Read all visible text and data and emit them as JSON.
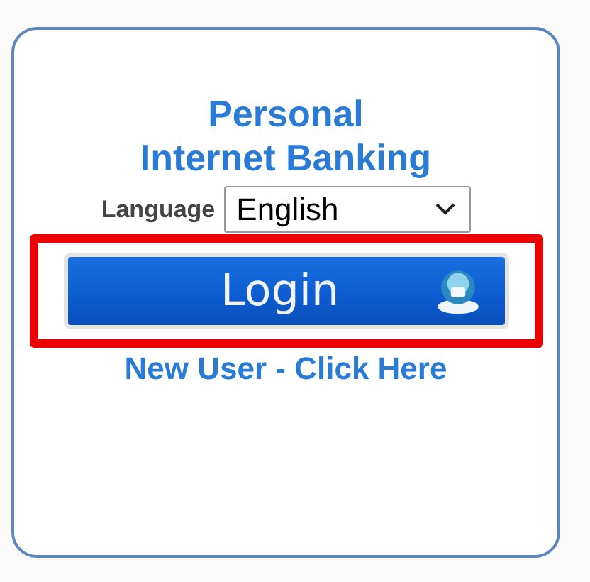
{
  "title": [
    "Personal",
    "Internet Banking"
  ],
  "language": {
    "label": "Language",
    "value": "English"
  },
  "login_button": {
    "label": "Login",
    "highlighted": true
  },
  "new_user_link": "New User - Click Here"
}
